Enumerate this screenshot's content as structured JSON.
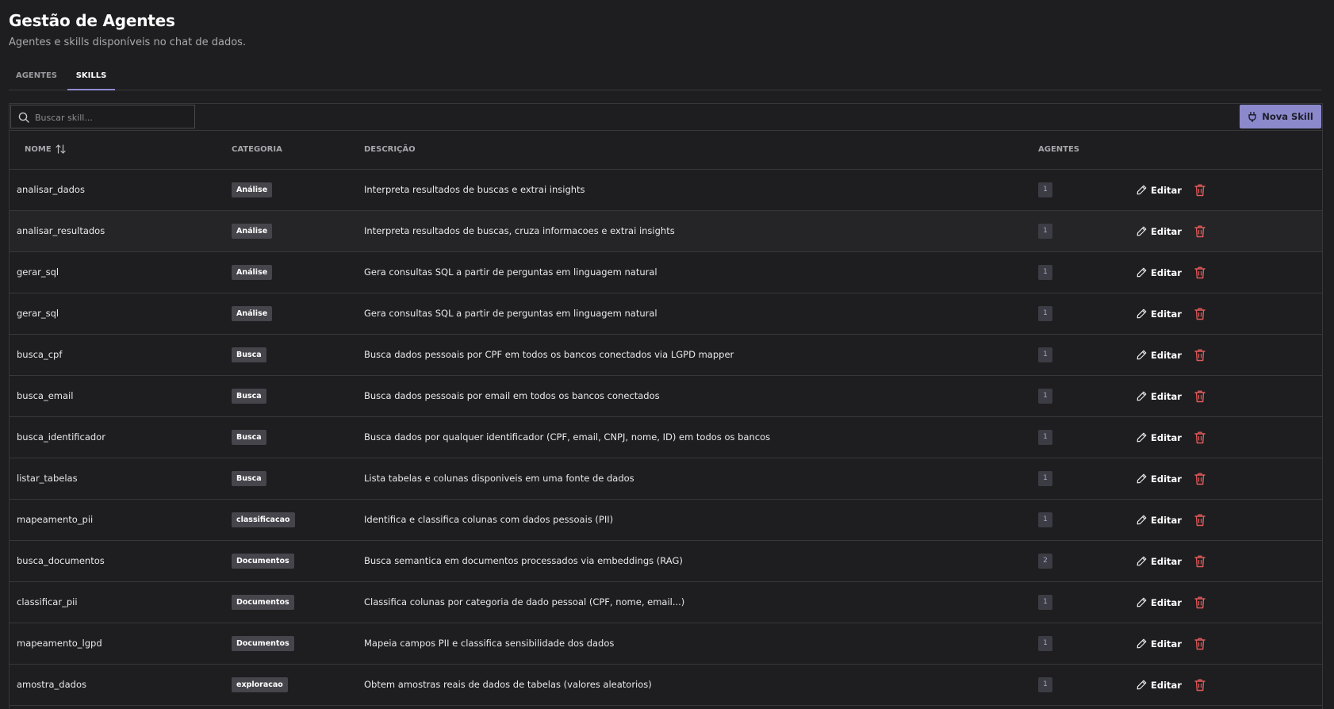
{
  "header": {
    "title": "Gestão de Agentes",
    "subtitle": "Agentes e skills disponíveis no chat de dados."
  },
  "tabs": [
    {
      "label": "AGENTES",
      "active": false
    },
    {
      "label": "SKILLS",
      "active": true
    }
  ],
  "toolbar": {
    "search_placeholder": "Buscar skill...",
    "search_icon": "search-icon",
    "new_button_label": "Nova Skill",
    "new_button_icon": "plug-icon"
  },
  "table": {
    "columns": [
      "NOME",
      "CATEGORIA",
      "DESCRIÇÃO",
      "AGENTES"
    ],
    "sort_icon": "sort-icon",
    "edit_label": "Editar",
    "rows": [
      {
        "name": "analisar_dados",
        "category": "Análise",
        "description": "Interpreta resultados de buscas e extrai insights",
        "agents": "1"
      },
      {
        "name": "analisar_resultados",
        "category": "Análise",
        "description": "Interpreta resultados de buscas, cruza informacoes e extrai insights",
        "agents": "1"
      },
      {
        "name": "gerar_sql",
        "category": "Análise",
        "description": "Gera consultas SQL a partir de perguntas em linguagem natural",
        "agents": "1"
      },
      {
        "name": "gerar_sql",
        "category": "Análise",
        "description": "Gera consultas SQL a partir de perguntas em linguagem natural",
        "agents": "1"
      },
      {
        "name": "busca_cpf",
        "category": "Busca",
        "description": "Busca dados pessoais por CPF em todos os bancos conectados via LGPD mapper",
        "agents": "1"
      },
      {
        "name": "busca_email",
        "category": "Busca",
        "description": "Busca dados pessoais por email em todos os bancos conectados",
        "agents": "1"
      },
      {
        "name": "busca_identificador",
        "category": "Busca",
        "description": "Busca dados por qualquer identificador (CPF, email, CNPJ, nome, ID) em todos os bancos",
        "agents": "1"
      },
      {
        "name": "listar_tabelas",
        "category": "Busca",
        "description": "Lista tabelas e colunas disponiveis em uma fonte de dados",
        "agents": "1"
      },
      {
        "name": "mapeamento_pii",
        "category": "classificacao",
        "description": "Identifica e classifica colunas com dados pessoais (PII)",
        "agents": "1"
      },
      {
        "name": "busca_documentos",
        "category": "Documentos",
        "description": "Busca semantica em documentos processados via embeddings (RAG)",
        "agents": "2"
      },
      {
        "name": "classificar_pii",
        "category": "Documentos",
        "description": "Classifica colunas por categoria de dado pessoal (CPF, nome, email...)",
        "agents": "1"
      },
      {
        "name": "mapeamento_lgpd",
        "category": "Documentos",
        "description": "Mapeia campos PII e classifica sensibilidade dos dados",
        "agents": "1"
      },
      {
        "name": "amostra_dados",
        "category": "exploracao",
        "description": "Obtem amostras reais de dados de tabelas (valores aleatorios)",
        "agents": "1"
      }
    ]
  },
  "colors": {
    "background": "#1e1e20",
    "accent": "#8b89cc",
    "delete": "#e05a5a",
    "badge": "#45454b"
  }
}
